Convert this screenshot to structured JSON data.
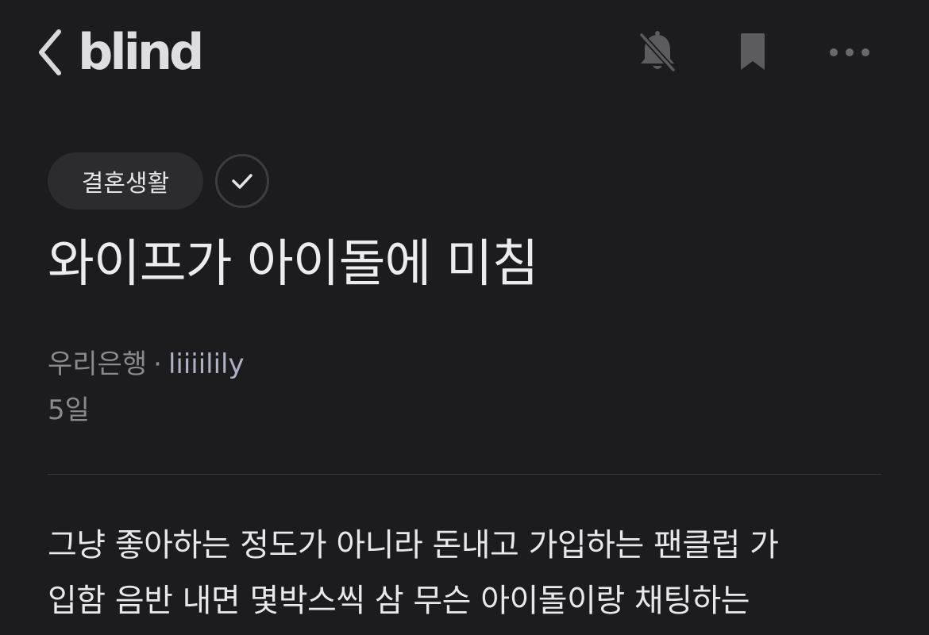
{
  "header": {
    "logo_text": "blind",
    "icons": {
      "back": "chevron-left-icon",
      "mute": "bell-off-icon",
      "bookmark": "bookmark-icon",
      "more": "more-horizontal-icon"
    }
  },
  "post": {
    "category": "결혼생활",
    "title": "와이프가 아이돌에 미침",
    "company": "우리은행",
    "separator": "·",
    "author": "liiiilily",
    "time": "5일",
    "body_lines": [
      "그냥 좋아하는 정도가 아니라 돈내고 가입하는 팬클럽 가",
      "입함 음반 내면 몇박스씩 삼 무슨 아이돌이랑 채팅하는"
    ]
  },
  "colors": {
    "background": "#1c1c1e",
    "chip_background": "#2c2c2e",
    "author": "#aeb0c4",
    "muted_text": "#8a8a8e"
  }
}
